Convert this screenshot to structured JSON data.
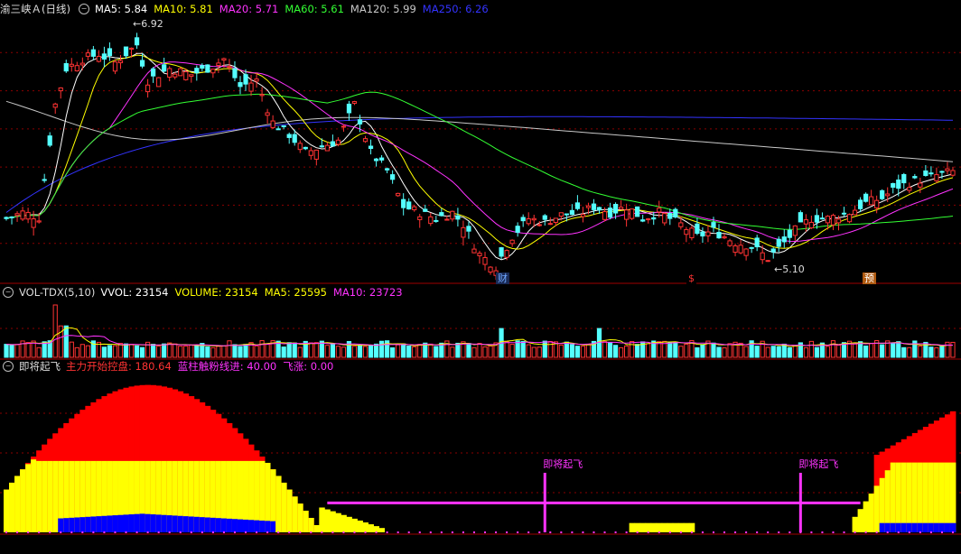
{
  "main_header": {
    "title": "渝三峡Ａ(日线)",
    "items": [
      {
        "label": "MA5: 5.84",
        "color": "#ffffff"
      },
      {
        "label": "MA10: 5.81",
        "color": "#ffff00"
      },
      {
        "label": "MA20: 5.71",
        "color": "#ff33ff"
      },
      {
        "label": "MA60: 5.61",
        "color": "#33ff33"
      },
      {
        "label": "MA120: 5.99",
        "color": "#c8c8c8"
      },
      {
        "label": "MA250: 6.26",
        "color": "#3333ff"
      }
    ]
  },
  "price_annotations": {
    "high": "6.92",
    "low": "5.10"
  },
  "event_tags": [
    {
      "text": "财",
      "color": "#6fa8ff",
      "bg": "#1a2a55"
    },
    {
      "text": "$",
      "color": "#ff3333",
      "bg": "#000000"
    },
    {
      "text": "预",
      "color": "#ffffff",
      "bg": "#b05a10"
    }
  ],
  "vol_header": {
    "title": "VOL-TDX(5,10)",
    "items": [
      {
        "label": "VVOL: 23154",
        "color": "#ffffff"
      },
      {
        "label": "VOLUME: 23154",
        "color": "#ffff00"
      },
      {
        "label": "MA5: 25595",
        "color": "#ffff00"
      },
      {
        "label": "MA10: 23723",
        "color": "#ff33ff"
      }
    ]
  },
  "ind_header": {
    "title": "即将起飞",
    "items": [
      {
        "label": "主力开始控盘: 180.64",
        "color": "#ff3333"
      },
      {
        "label": "蓝柱触粉线进: 40.00",
        "color": "#ff33ff"
      },
      {
        "label": "飞涨: 0.00",
        "color": "#ff33ff"
      }
    ]
  },
  "signals": [
    {
      "label": "即将起飞",
      "bar": 99
    },
    {
      "label": "即将起飞",
      "bar": 146
    }
  ],
  "colors": {
    "up": "#ff3333",
    "down": "#54ffff",
    "ma5": "#ffffff",
    "ma10": "#ffff00",
    "ma20": "#ff33ff",
    "ma60": "#33ff33",
    "ma120": "#c8c8c8",
    "ma250": "#3333ff",
    "grid": "#8a0000",
    "frame": "#a00000",
    "ind_red": "#ff0000",
    "ind_yellow": "#ffff00",
    "ind_blue": "#0000ff",
    "ind_pink": "#ff33ff"
  },
  "chart_data": {
    "type": "candlestick",
    "bars": 175,
    "y_range": [
      5.0,
      7.0
    ],
    "close_path": [
      [
        0,
        5.45
      ],
      [
        3,
        5.5
      ],
      [
        6,
        5.46
      ],
      [
        9,
        6.4
      ],
      [
        11,
        6.7
      ],
      [
        14,
        6.78
      ],
      [
        17,
        6.82
      ],
      [
        20,
        6.75
      ],
      [
        24,
        6.9
      ],
      [
        26,
        6.6
      ],
      [
        30,
        6.7
      ],
      [
        34,
        6.65
      ],
      [
        38,
        6.72
      ],
      [
        40,
        6.78
      ],
      [
        43,
        6.55
      ],
      [
        46,
        6.6
      ],
      [
        49,
        6.25
      ],
      [
        52,
        6.15
      ],
      [
        55,
        6.0
      ],
      [
        58,
        6.05
      ],
      [
        61,
        6.1
      ],
      [
        64,
        6.4
      ],
      [
        67,
        6.0
      ],
      [
        70,
        5.85
      ],
      [
        73,
        5.55
      ],
      [
        76,
        5.5
      ],
      [
        79,
        5.45
      ],
      [
        82,
        5.5
      ],
      [
        84,
        5.4
      ],
      [
        87,
        5.15
      ],
      [
        90,
        5.05
      ],
      [
        93,
        5.3
      ],
      [
        96,
        5.45
      ],
      [
        99,
        5.42
      ],
      [
        102,
        5.48
      ],
      [
        106,
        5.5
      ],
      [
        108,
        5.55
      ],
      [
        111,
        5.5
      ],
      [
        114,
        5.55
      ],
      [
        117,
        5.45
      ],
      [
        120,
        5.5
      ],
      [
        124,
        5.4
      ],
      [
        127,
        5.3
      ],
      [
        130,
        5.35
      ],
      [
        134,
        5.25
      ],
      [
        137,
        5.22
      ],
      [
        140,
        5.12
      ],
      [
        142,
        5.2
      ],
      [
        145,
        5.35
      ],
      [
        148,
        5.45
      ],
      [
        151,
        5.45
      ],
      [
        155,
        5.5
      ],
      [
        158,
        5.58
      ],
      [
        161,
        5.62
      ],
      [
        164,
        5.72
      ],
      [
        167,
        5.76
      ],
      [
        170,
        5.8
      ],
      [
        174,
        5.84
      ]
    ],
    "ma_values_last": {
      "MA5": 5.84,
      "MA10": 5.81,
      "MA20": 5.71,
      "MA60": 5.61,
      "MA120": 5.99,
      "MA250": 6.26
    }
  }
}
